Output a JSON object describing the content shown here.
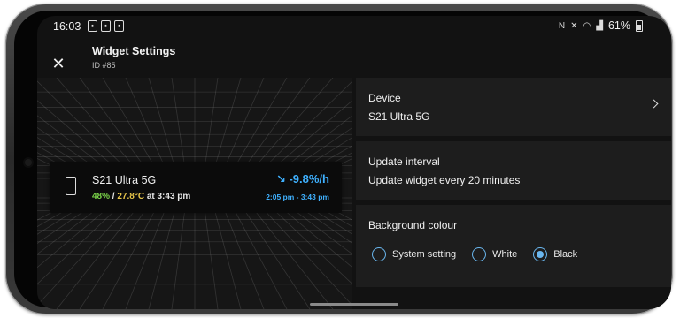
{
  "status_bar": {
    "time": "16:03",
    "left_icons": [
      "notification-icon",
      "notification-icon",
      "notification-icon"
    ],
    "right_icons": [
      "nfc-icon",
      "mute-icon",
      "wifi-icon",
      "signal-icon"
    ],
    "battery_percent": "61%"
  },
  "header": {
    "title": "Widget Settings",
    "subtitle": "ID #85"
  },
  "widget_preview": {
    "device_name": "S21 Ultra 5G",
    "battery_level": "48%",
    "separator": "/",
    "temperature": "27.8°C",
    "time_text": "at 3:43 pm",
    "rate": "↘ -9.8%/h",
    "range": "2:05 pm - 3:43 pm"
  },
  "settings": {
    "device": {
      "title": "Device",
      "value": "S21 Ultra 5G"
    },
    "update_interval": {
      "title": "Update interval",
      "value": "Update widget every 20 minutes"
    },
    "background": {
      "title": "Background colour",
      "options": [
        {
          "label": "System setting",
          "selected": false
        },
        {
          "label": "White",
          "selected": false
        },
        {
          "label": "Black",
          "selected": true
        }
      ]
    }
  },
  "colors": {
    "accent": "#6ab7ef",
    "rate_blue": "#3fb1ff",
    "battery_green": "#7bd44a",
    "temp_yellow": "#e8c64a"
  }
}
